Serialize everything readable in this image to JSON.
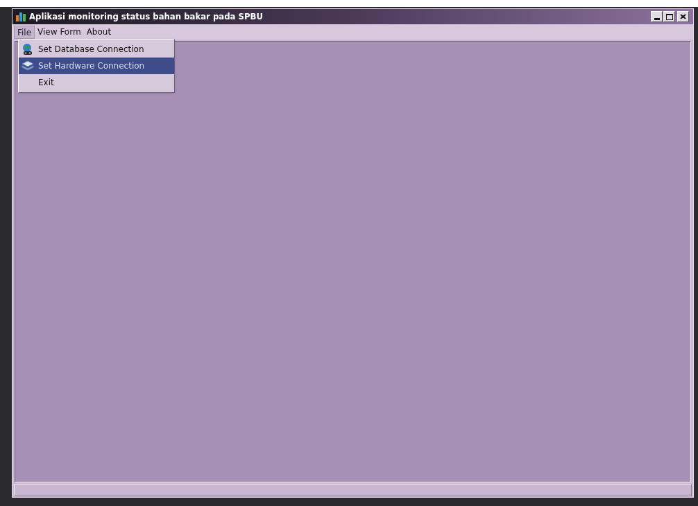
{
  "window": {
    "title": "Aplikasi monitoring status bahan bakar pada SPBU"
  },
  "menu_bar": [
    {
      "label": "File",
      "selected": true
    },
    {
      "label": "View Form",
      "selected": false
    },
    {
      "label": "About",
      "selected": false
    }
  ],
  "file_menu": [
    {
      "label": "Set Database Connection",
      "kind": "database",
      "selected": false
    },
    {
      "label": "Set Hardware Connection",
      "kind": "hardware",
      "selected": true
    },
    {
      "label": "Exit",
      "kind": "plain",
      "selected": false
    }
  ]
}
